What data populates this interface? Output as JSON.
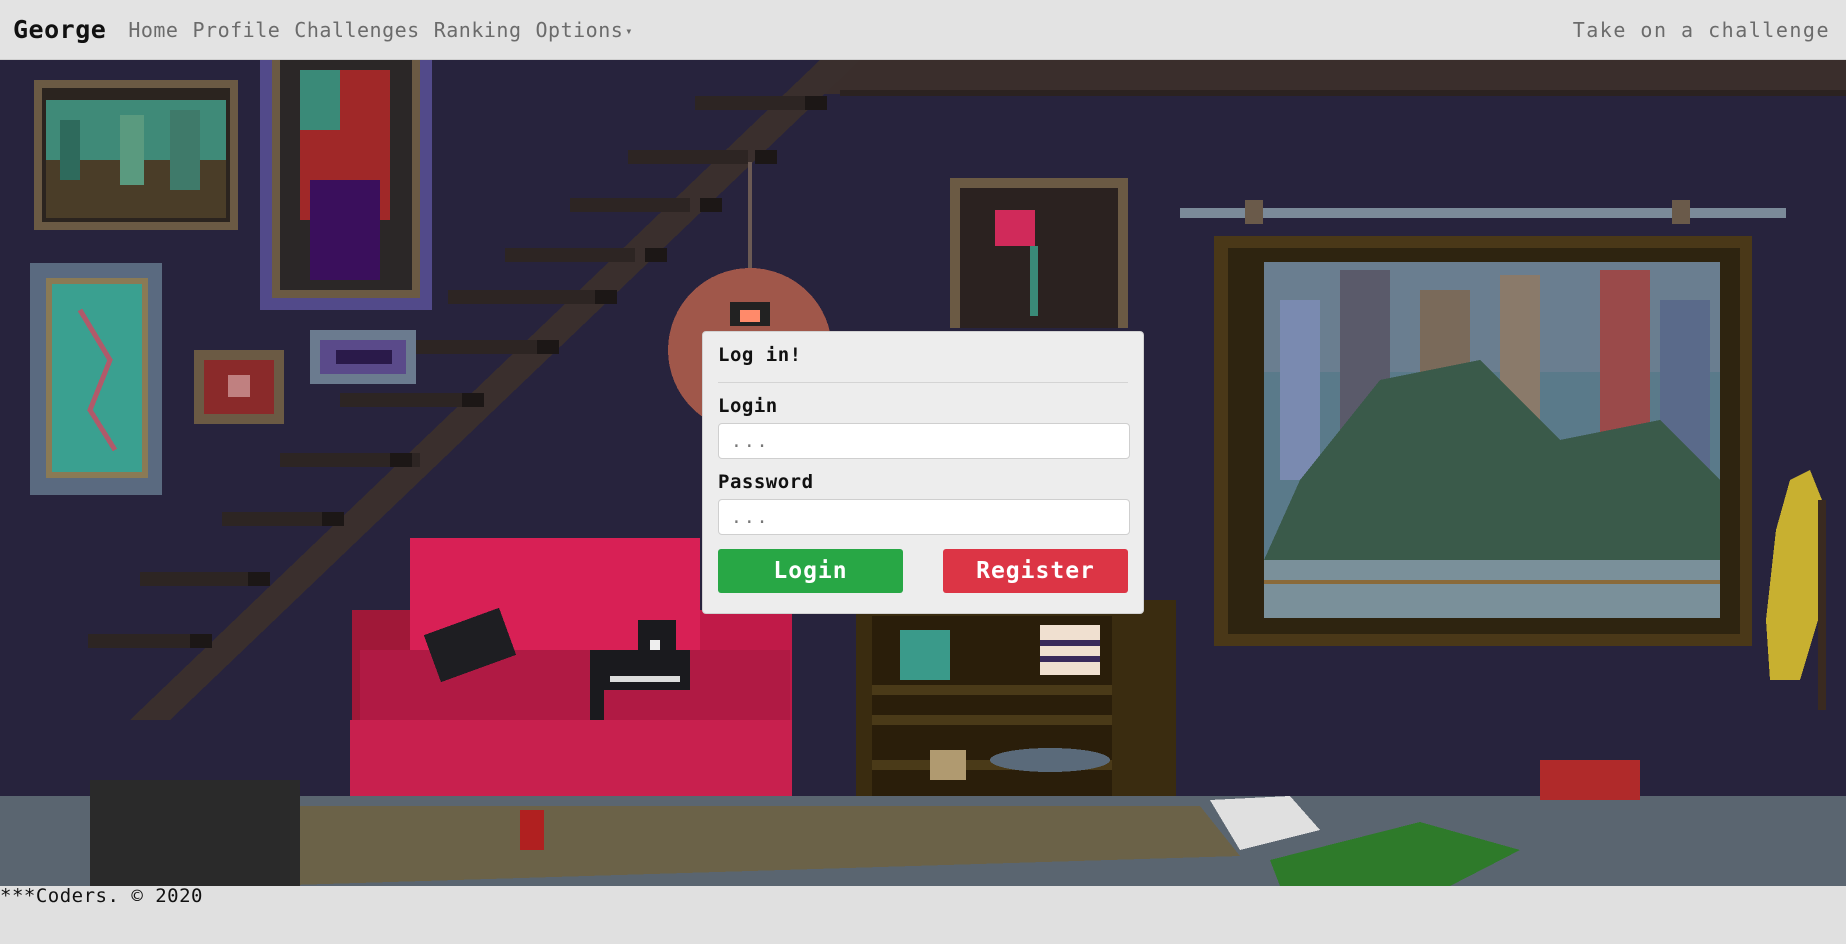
{
  "navbar": {
    "brand": "George",
    "links": [
      {
        "label": "Home"
      },
      {
        "label": "Profile"
      },
      {
        "label": "Challenges"
      },
      {
        "label": "Ranking"
      },
      {
        "label": "Options"
      }
    ],
    "right_link": "Take on a challenge"
  },
  "login_card": {
    "title": "Log in!",
    "login_label": "Login",
    "login_placeholder": "...",
    "password_label": "Password",
    "password_placeholder": "...",
    "login_button": "Login",
    "register_button": "Register"
  },
  "footer": {
    "text": "***Coders. © 2020"
  },
  "colors": {
    "navbar_bg": "#e3e3e3",
    "scene_bg": "#27233d",
    "login_button": "#28a745",
    "register_button": "#dc3545"
  },
  "icons": {
    "options_dropdown": "caret-down-icon"
  }
}
